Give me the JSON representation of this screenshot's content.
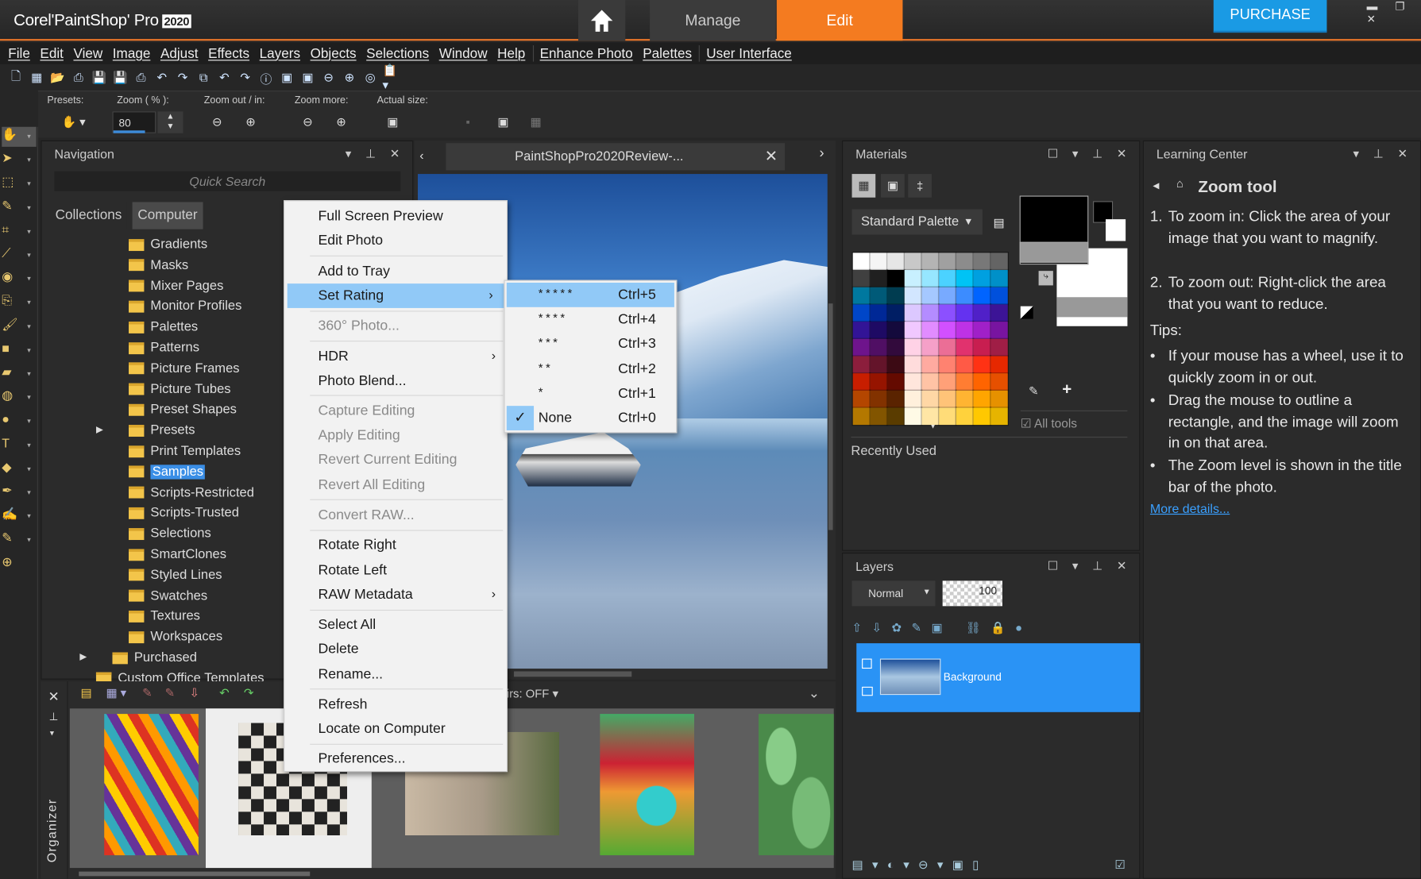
{
  "app": {
    "brand": "Corel",
    "product": "PaintShop",
    "pro": "Pro",
    "year": "2020"
  },
  "workspace_tabs": [
    {
      "label": "Manage"
    },
    {
      "label": "Edit",
      "active": true
    }
  ],
  "purchase_label": "PURCHASE",
  "window_controls": "▬ ❐ ✕",
  "colors": {
    "accent_orange": "#f47b20",
    "purchase_blue": "#1a9ae4",
    "selection_blue": "#2a93f5",
    "menu_highlight": "#91c9f7"
  },
  "menu": [
    "File",
    "Edit",
    "View",
    "Image",
    "Adjust",
    "Effects",
    "Layers",
    "Objects",
    "Selections",
    "Window",
    "Help",
    "|",
    "Enhance Photo",
    "Palettes",
    "|",
    "User Interface"
  ],
  "toolbar_icons": [
    "new-file",
    "browse",
    "open",
    "scan",
    "save",
    "save-as",
    "print",
    "undo",
    "redo",
    "history",
    "revert",
    "restore",
    "info",
    "fit",
    "zoom-fit",
    "zoom-out",
    "zoom-in",
    "actual",
    "paste-as"
  ],
  "tool_options": {
    "presets_label": "Presets:",
    "zoom_label": "Zoom ( % ):",
    "zoom_value": "80",
    "zoom_out_in_label": "Zoom out / in:",
    "zoom_more_label": "Zoom more:",
    "actual_size_label": "Actual size:"
  },
  "tools": [
    "pan",
    "pick",
    "selection",
    "dropper",
    "crop",
    "straighten",
    "red-eye",
    "clone",
    "paint-brush",
    "fill",
    "eraser",
    "picture-tube",
    "smudge",
    "text",
    "preset-shape",
    "pen",
    "draw",
    "warp",
    "add"
  ],
  "navigation": {
    "title": "Navigation",
    "search_placeholder": "Quick Search",
    "tabs": [
      "Collections",
      "Computer"
    ],
    "folders": [
      "Gradients",
      "Masks",
      "Mixer Pages",
      "Monitor Profiles",
      "Palettes",
      "Patterns",
      "Picture Frames",
      "Picture Tubes",
      "Preset Shapes",
      "Presets",
      "Print Templates",
      "Samples",
      "Scripts-Restricted",
      "Scripts-Trusted",
      "Selections",
      "SmartClones",
      "Styled Lines",
      "Swatches",
      "Textures",
      "Workspaces"
    ],
    "selected_folder": "Samples",
    "parent_folders": [
      "Purchased",
      "Custom Office Templates"
    ]
  },
  "document": {
    "tab_title": "PaintShopPro2020Review-..."
  },
  "organizer": {
    "label": "Organizer",
    "crosshairs": "irs: OFF"
  },
  "materials": {
    "title": "Materials",
    "palette": "Standard Palette",
    "all_tools": "All tools",
    "recently_used": "Recently Used",
    "swatches": [
      [
        "#ffffff",
        "#f5f5f5",
        "#e6e6e6",
        "#c8c8c8",
        "#b4b4b4",
        "#a0a0a0",
        "#8c8c8c",
        "#787878",
        "#646464"
      ],
      [
        "#404040",
        "#202020",
        "#000000",
        "#c8f0ff",
        "#96e6ff",
        "#4bd2ff",
        "#00c3f5",
        "#00a0e0",
        "#0090c8"
      ],
      [
        "#00789f",
        "#005a78",
        "#003c50",
        "#d2e6ff",
        "#a5c8ff",
        "#78aaff",
        "#3c8cff",
        "#0064ff",
        "#0050dc"
      ],
      [
        "#0046c8",
        "#002896",
        "#001e64",
        "#dcc8ff",
        "#b48cff",
        "#8c50ff",
        "#6432f0",
        "#5020c8",
        "#3c1496"
      ],
      [
        "#321496",
        "#1e0a64",
        "#140a3c",
        "#f0c8ff",
        "#e18cff",
        "#d250ff",
        "#be32e6",
        "#a020c8",
        "#7814a0"
      ],
      [
        "#6e148c",
        "#500f64",
        "#320a3c",
        "#ffd2e6",
        "#f5a0c8",
        "#eb6e96",
        "#e1326e",
        "#c81e50",
        "#a01e46"
      ],
      [
        "#8c1e3c",
        "#64142a",
        "#3c0a14",
        "#ffdcdc",
        "#ffaaa0",
        "#ff8270",
        "#ff5a46",
        "#ff3214",
        "#e62800"
      ],
      [
        "#c81e00",
        "#961400",
        "#640a00",
        "#ffe6dc",
        "#ffc3a5",
        "#ffa078",
        "#ff7d32",
        "#ff6400",
        "#e65000"
      ],
      [
        "#b44600",
        "#823200",
        "#5a2300",
        "#fff0dc",
        "#ffd7a5",
        "#ffc378",
        "#ffb432",
        "#ffa500",
        "#e69100"
      ],
      [
        "#b47800",
        "#825500",
        "#5a3c00",
        "#fffae6",
        "#ffe6a5",
        "#ffdc78",
        "#ffd23c",
        "#ffc800",
        "#e6b400"
      ]
    ],
    "foreground": "#000000",
    "background": "#ffffff"
  },
  "layers": {
    "title": "Layers",
    "blend_mode": "Normal",
    "opacity": "100",
    "items": [
      {
        "name": "Background",
        "selected": true
      }
    ]
  },
  "learning_center": {
    "title": "Learning Center",
    "heading": "Zoom tool",
    "steps": [
      {
        "n": "1.",
        "text": "To zoom in: Click the area of your image that you want to magnify."
      },
      {
        "n": "2.",
        "text": "To zoom out: Right-click the area that you want to reduce."
      }
    ],
    "tips_label": "Tips:",
    "tips": [
      "If your mouse has a wheel, use it to quickly zoom in or out.",
      "Drag the mouse to outline a rectangle, and the image will zoom in on that area.",
      "The Zoom level is shown in the title bar of the photo."
    ],
    "more_link": "More details..."
  },
  "context_menu": [
    {
      "label": "Full Screen Preview"
    },
    {
      "label": "Edit Photo"
    },
    {
      "sep": true
    },
    {
      "label": "Add to Tray"
    },
    {
      "label": "Set Rating",
      "submenu": true,
      "highlight": true
    },
    {
      "sep": true
    },
    {
      "label": "360° Photo...",
      "disabled": true
    },
    {
      "sep": true
    },
    {
      "label": "HDR",
      "submenu": true
    },
    {
      "label": "Photo Blend..."
    },
    {
      "sep": true
    },
    {
      "label": "Capture Editing",
      "disabled": true
    },
    {
      "label": "Apply Editing",
      "disabled": true
    },
    {
      "label": "Revert Current Editing",
      "disabled": true
    },
    {
      "label": "Revert All Editing",
      "disabled": true
    },
    {
      "sep": true
    },
    {
      "label": "Convert RAW...",
      "disabled": true
    },
    {
      "sep": true
    },
    {
      "label": "Rotate Right"
    },
    {
      "label": "Rotate Left"
    },
    {
      "label": "RAW Metadata",
      "submenu": true
    },
    {
      "sep": true
    },
    {
      "label": "Select All"
    },
    {
      "label": "Delete"
    },
    {
      "label": "Rename..."
    },
    {
      "sep": true
    },
    {
      "label": "Refresh"
    },
    {
      "label": "Locate on Computer"
    },
    {
      "sep": true
    },
    {
      "label": "Preferences..."
    }
  ],
  "rating_submenu": [
    {
      "stars": "*****",
      "shortcut": "Ctrl+5",
      "highlight": true
    },
    {
      "stars": "****",
      "shortcut": "Ctrl+4"
    },
    {
      "stars": "***",
      "shortcut": "Ctrl+3"
    },
    {
      "stars": "**",
      "shortcut": "Ctrl+2"
    },
    {
      "stars": "*",
      "shortcut": "Ctrl+1"
    },
    {
      "stars": "None",
      "shortcut": "Ctrl+0",
      "checked": true
    }
  ],
  "current_rating": 0
}
